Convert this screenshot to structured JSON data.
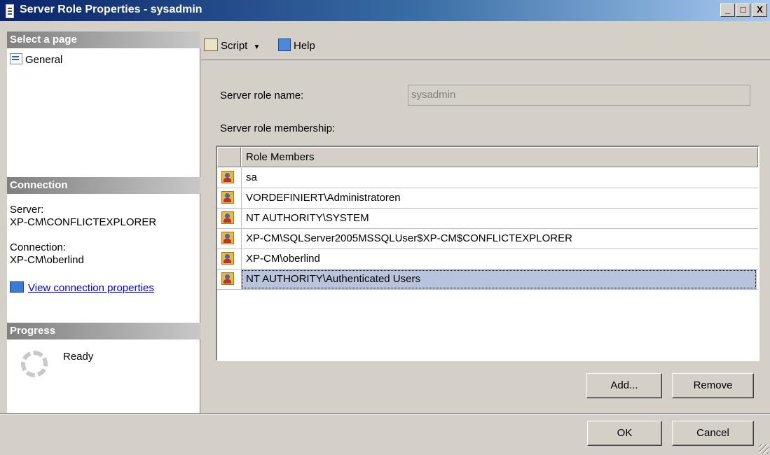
{
  "window": {
    "title": "Server Role Properties - sysadmin",
    "minimize_label": "_",
    "maximize_label": "□",
    "close_label": "X"
  },
  "sidebar": {
    "select_page_header": "Select a page",
    "pages": [
      {
        "label": "General",
        "icon": "properties-icon"
      }
    ],
    "connection_header": "Connection",
    "server_label": "Server:",
    "server_value": "XP-CM\\CONFLICTEXPLORER",
    "connection_label": "Connection:",
    "connection_value": "XP-CM\\oberlind",
    "view_connection_link": "View connection properties",
    "progress_header": "Progress",
    "progress_status": "Ready"
  },
  "toolbar": {
    "script_label": "Script",
    "help_label": "Help"
  },
  "form": {
    "role_name_label": "Server role name:",
    "role_name_value": "sysadmin",
    "membership_label": "Server role membership:"
  },
  "members_table": {
    "column_header": "Role Members",
    "rows": [
      "sa",
      "VORDEFINIERT\\Administratoren",
      "NT AUTHORITY\\SYSTEM",
      "XP-CM\\SQLServer2005MSSQLUser$XP-CM$CONFLICTEXPLORER",
      "XP-CM\\oberlind",
      "NT AUTHORITY\\Authenticated Users"
    ],
    "selected_row": "NT AUTHORITY\\Authenticated Users"
  },
  "buttons": {
    "add": "Add...",
    "remove": "Remove",
    "ok": "OK",
    "cancel": "Cancel"
  }
}
